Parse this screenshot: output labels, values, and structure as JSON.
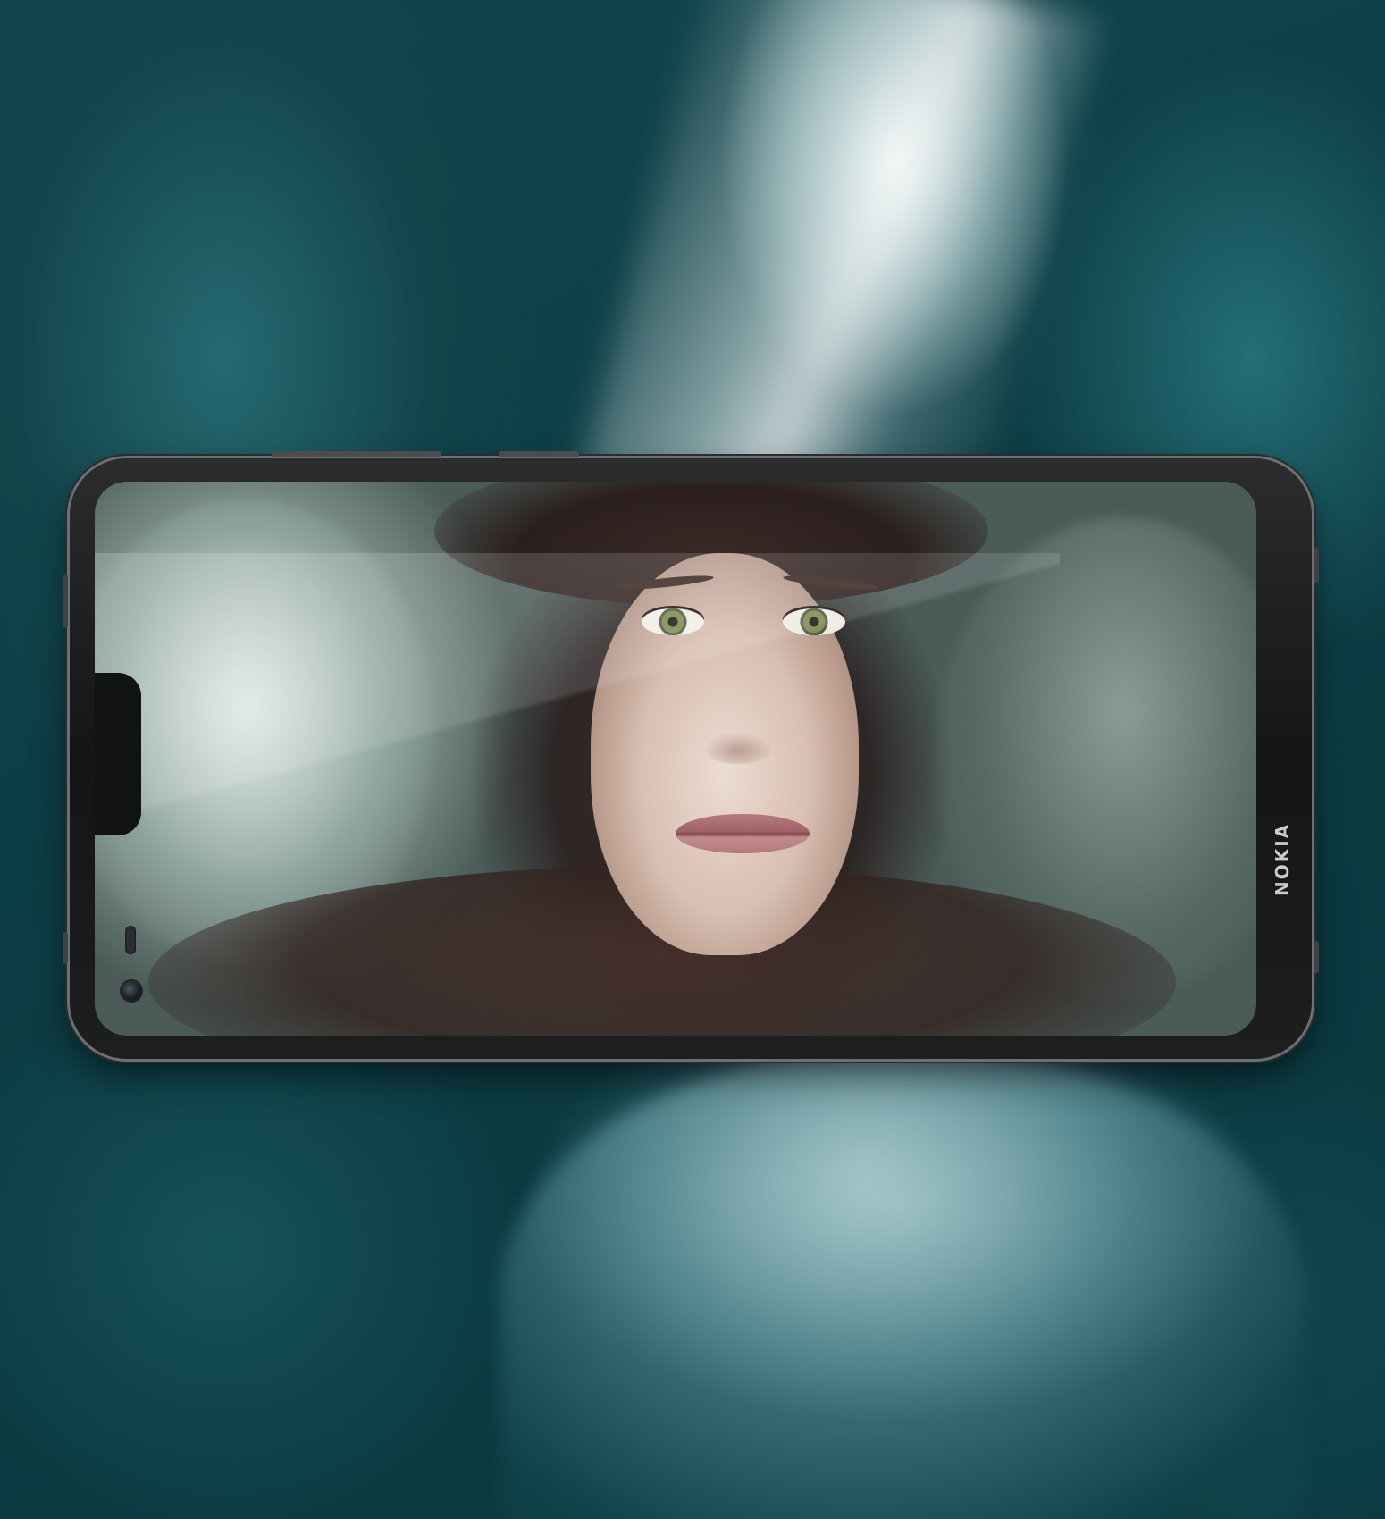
{
  "phone": {
    "brand_logo": "NOKIA"
  },
  "colors": {
    "background_ice": "#114a52",
    "phone_body": "#141516",
    "phone_rim": "#6d6f72"
  },
  "icons": {
    "front_camera": "camera-lens",
    "earpiece": "speaker-slot"
  }
}
